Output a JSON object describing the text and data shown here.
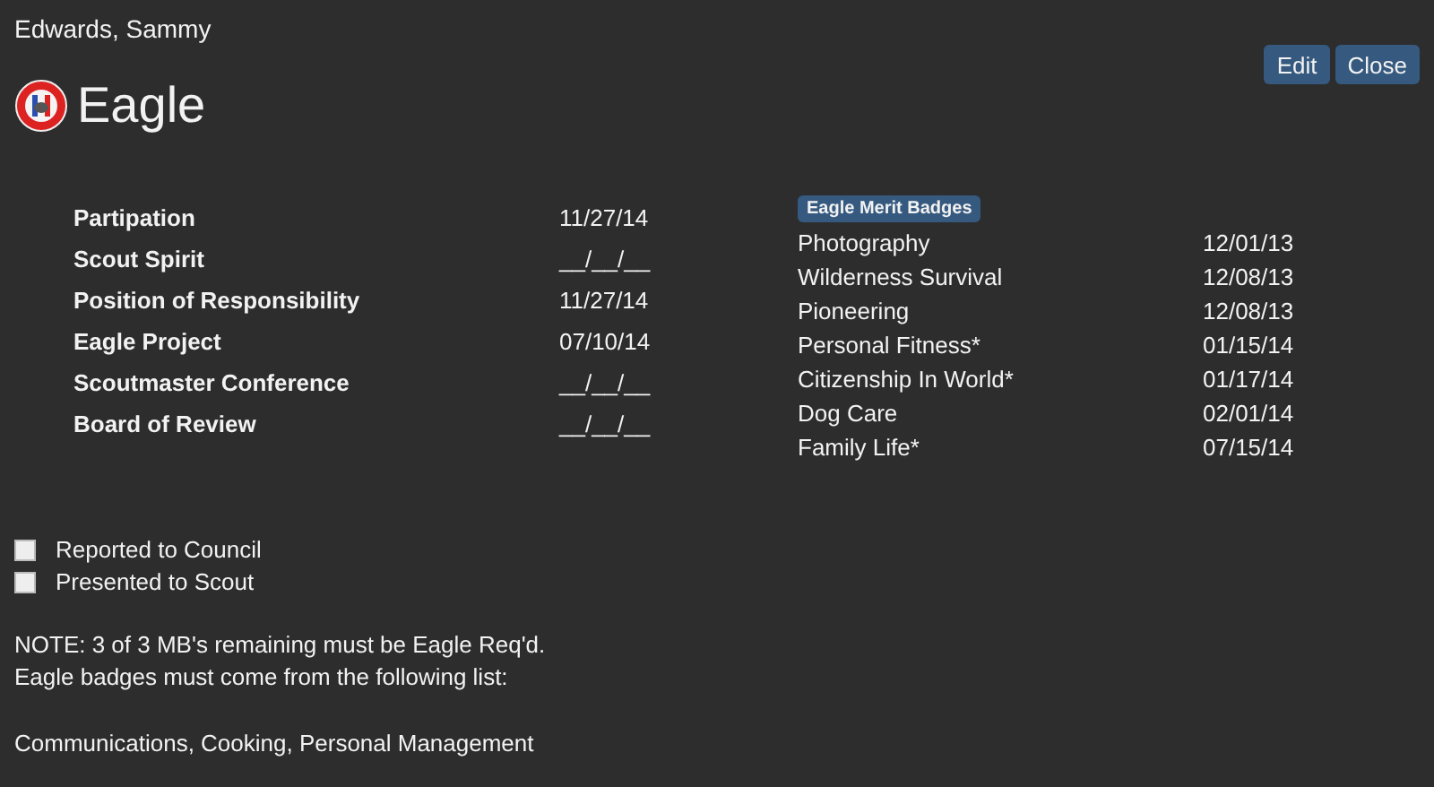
{
  "scout_name": "Edwards, Sammy",
  "buttons": [
    "Edit",
    "Close"
  ],
  "title": "Eagle",
  "requirements": [
    {
      "label": "Partipation",
      "date": "11/27/14"
    },
    {
      "label": "Scout Spirit",
      "date": "__/__/__"
    },
    {
      "label": "Position of Responsibility",
      "date": "11/27/14"
    },
    {
      "label": "Eagle Project",
      "date": "07/10/14"
    },
    {
      "label": "Scoutmaster Conference",
      "date": "__/__/__"
    },
    {
      "label": "Board of Review",
      "date": "__/__/__"
    }
  ],
  "merit_badges": {
    "tag": "Eagle Merit Badges",
    "rows": [
      {
        "name": "Photography",
        "date": "12/01/13"
      },
      {
        "name": "Wilderness Survival",
        "date": "12/08/13"
      },
      {
        "name": "Pioneering",
        "date": "12/08/13"
      },
      {
        "name": "Personal Fitness*",
        "date": "01/15/14"
      },
      {
        "name": "Citizenship In World*",
        "date": "01/17/14"
      },
      {
        "name": "Dog Care",
        "date": "02/01/14"
      },
      {
        "name": "Family Life*",
        "date": "07/15/14"
      }
    ]
  },
  "checkboxes": [
    {
      "label": "Reported to Council",
      "checked": false
    },
    {
      "label": "Presented to Scout",
      "checked": false
    }
  ],
  "note_lines": [
    "NOTE: 3 of 3 MB's remaining must be Eagle Req'd.",
    "Eagle badges must come from the following list:"
  ],
  "badge_list": "Communications, Cooking, Personal Management"
}
